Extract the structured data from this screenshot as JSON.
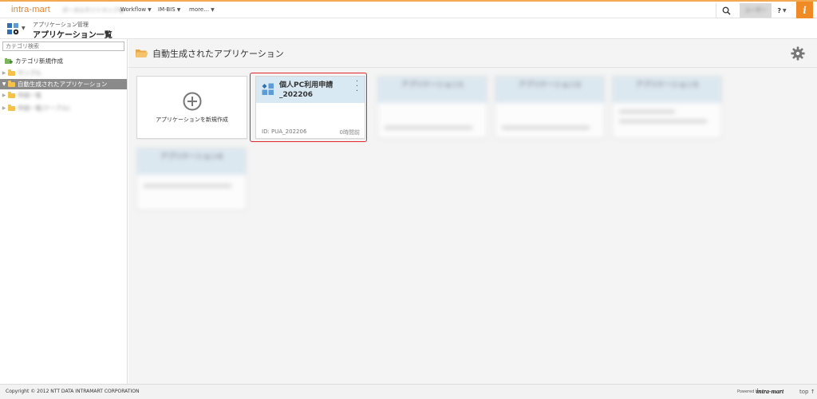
{
  "topbar": {
    "logo": "intra-mart",
    "nav": [
      {
        "label": "ポータル",
        "blurred": true,
        "has_caret": false
      },
      {
        "label": "サイトマップ",
        "blurred": true,
        "has_caret": true
      },
      {
        "label": "Workflow",
        "blurred": false,
        "has_caret": true
      },
      {
        "label": "IM-BIS",
        "blurred": false,
        "has_caret": true
      },
      {
        "label": "more…",
        "blurred": false,
        "has_caret": true
      }
    ],
    "user_label": "ユーザー",
    "help_label": "?",
    "im_label": "i"
  },
  "header": {
    "subtitle": "アプリケーション管理",
    "title": "アプリケーション一覧"
  },
  "sidebar": {
    "search_placeholder": "カテゴリ検索",
    "new_category_label": "カテゴリ新規作成",
    "tree": [
      {
        "label": "サンプル",
        "blurred": true,
        "selected": false
      },
      {
        "label": "自動生成されたアプリケーション",
        "blurred": false,
        "selected": true
      },
      {
        "label": "申請一覧",
        "blurred": true,
        "selected": false
      },
      {
        "label": "申請一覧(テーブル)",
        "blurred": true,
        "selected": false
      }
    ]
  },
  "main": {
    "title": "自動生成されたアプリケーション",
    "create_card_label": "アプリケーションを新規作成",
    "app_card": {
      "title_line1": "個人PC利用申請",
      "title_line2": "_202206",
      "id_text": "ID: PUA_202206",
      "time_text": "0時間前"
    },
    "blurred_cards": [
      {
        "title": "アプリケーション1"
      },
      {
        "title": "アプリケーション2"
      },
      {
        "title": "アプリケーション3"
      },
      {
        "title": "アプリケーション4"
      }
    ]
  },
  "footer": {
    "copyright": "Copyright © 2012 NTT DATA INTRAMART CORPORATION",
    "powered_by": "Powered by",
    "powered_logo": "intra-mart",
    "top_link": "top ↑"
  },
  "colors": {
    "accent": "#f08a24",
    "selection_border": "#e0242a",
    "card_header": "#d9e9f3",
    "selected_tree": "#8a8a8a"
  }
}
